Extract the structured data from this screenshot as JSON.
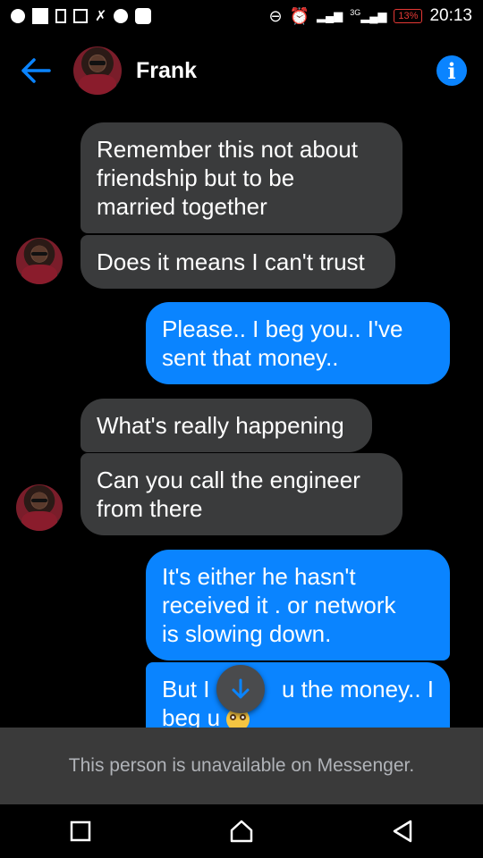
{
  "status_bar": {
    "time": "20:13",
    "battery": "13%",
    "network": "3G",
    "icons": [
      "messenger-icon",
      "image-icon",
      "phone-outline-icon",
      "gallery-icon",
      "missed-call-icon",
      "messenger-icon",
      "youtube-icon",
      "do-not-disturb-icon",
      "alarm-icon",
      "signal-icon",
      "signal-3g-icon",
      "battery-icon"
    ]
  },
  "header": {
    "contact_name": "Frank",
    "back_icon": "arrow-left-icon",
    "info_icon": "info-icon",
    "accent": "#0a84ff"
  },
  "messages": [
    {
      "direction": "incoming",
      "lines": [
        "Remember this not about",
        "friendship but to be",
        "married together"
      ]
    },
    {
      "direction": "incoming",
      "lines": [
        "Does it means I can't trust"
      ]
    },
    {
      "direction": "outgoing",
      "lines": [
        "Please.. I beg you..  I've",
        "sent that money.."
      ]
    },
    {
      "direction": "incoming",
      "lines": [
        "What's really happening"
      ]
    },
    {
      "direction": "incoming",
      "lines": [
        "Can you call the engineer",
        "from there"
      ]
    },
    {
      "direction": "outgoing",
      "lines": [
        "It's either he hasn't",
        "received it . or network",
        "is slowing down."
      ]
    },
    {
      "direction": "outgoing",
      "lines": [
        "But I",
        "u the money.. I",
        "beg u"
      ],
      "emoji": "pleading-face-emoji"
    }
  ],
  "scroll_to_bottom_icon": "arrow-down-icon",
  "footer": {
    "unavailable_text": "This person is unavailable on Messenger."
  },
  "nav": {
    "recent_icon": "square-icon",
    "home_icon": "home-icon",
    "back_icon": "triangle-back-icon"
  },
  "colors": {
    "incoming_bubble": "#3a3b3c",
    "outgoing_bubble": "#0a84ff",
    "background": "#000000"
  }
}
